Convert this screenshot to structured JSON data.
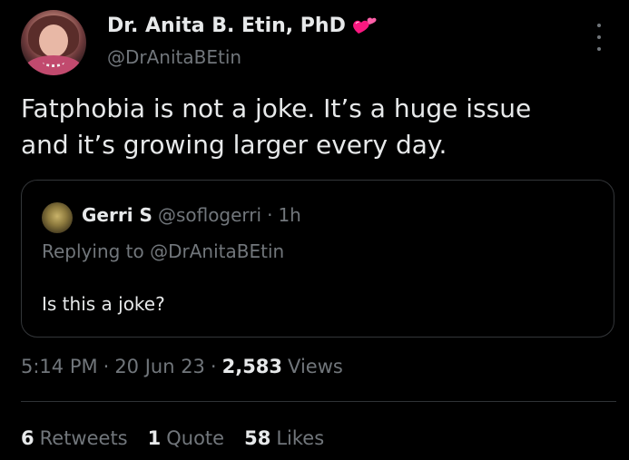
{
  "author": {
    "display_name": "Dr. Anita B. Etin, PhD",
    "handle": "@DrAnitaBEtin",
    "badge_icon": "heart-emoji-icon"
  },
  "tweet": {
    "text": "Fatphobia is not a joke. It’s a huge issue\nand it’s growing larger every day."
  },
  "quoted_tweet": {
    "author_name": "Gerri S",
    "author_handle": "@soflogerri",
    "separator": "·",
    "age": "1h",
    "replying_prefix": "Replying to",
    "replying_to": "@DrAnitaBEtin",
    "text": "Is this a joke?"
  },
  "meta": {
    "time": "5:14 PM",
    "date": "20 Jun 23",
    "separator": "·",
    "views_count": "2,583",
    "views_label": "Views"
  },
  "stats": {
    "retweets_count": "6",
    "retweets_label": "Retweets",
    "quotes_count": "1",
    "quotes_label": "Quote",
    "likes_count": "58",
    "likes_label": "Likes"
  },
  "colors": {
    "background": "#000000",
    "primary_text": "#e7e9ea",
    "secondary_text": "#71767b",
    "border": "#333639",
    "heart": "#f91880"
  }
}
